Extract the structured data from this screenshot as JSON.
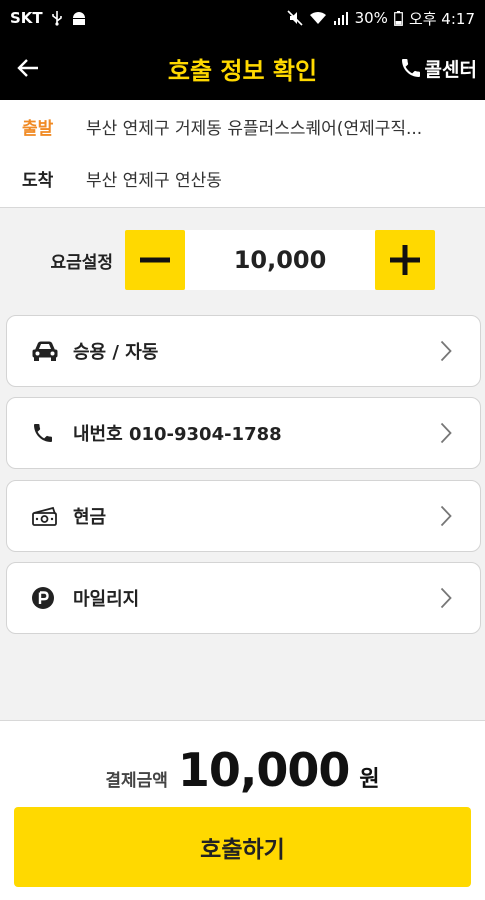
{
  "status_bar": {
    "carrier": "SKT",
    "battery": "30%",
    "time": "오후 4:17"
  },
  "app_bar": {
    "title": "호출 정보 확인",
    "call_center": "콜센터"
  },
  "route": {
    "departure_tag": "출발",
    "departure": "부산 연제구 거제동 유플러스스퀘어(연제구직...",
    "arrival_tag": "도착",
    "arrival": "부산 연제구 연산동"
  },
  "fare": {
    "label": "요금설정",
    "value": "10,000"
  },
  "options": [
    {
      "label": "승용 / 자동",
      "icon": "car-icon"
    },
    {
      "label": "내번호 010-9304-1788",
      "icon": "phone-icon"
    },
    {
      "label": "현금",
      "icon": "cash-icon"
    },
    {
      "label": "마일리지",
      "icon": "mileage-p-icon"
    }
  ],
  "payment": {
    "label": "결제금액",
    "amount": "10,000",
    "unit": "원"
  },
  "call_button": "호출하기",
  "colors": {
    "accent": "#ffd900",
    "header_bg": "#000000",
    "departure_tag": "#f08a24"
  }
}
